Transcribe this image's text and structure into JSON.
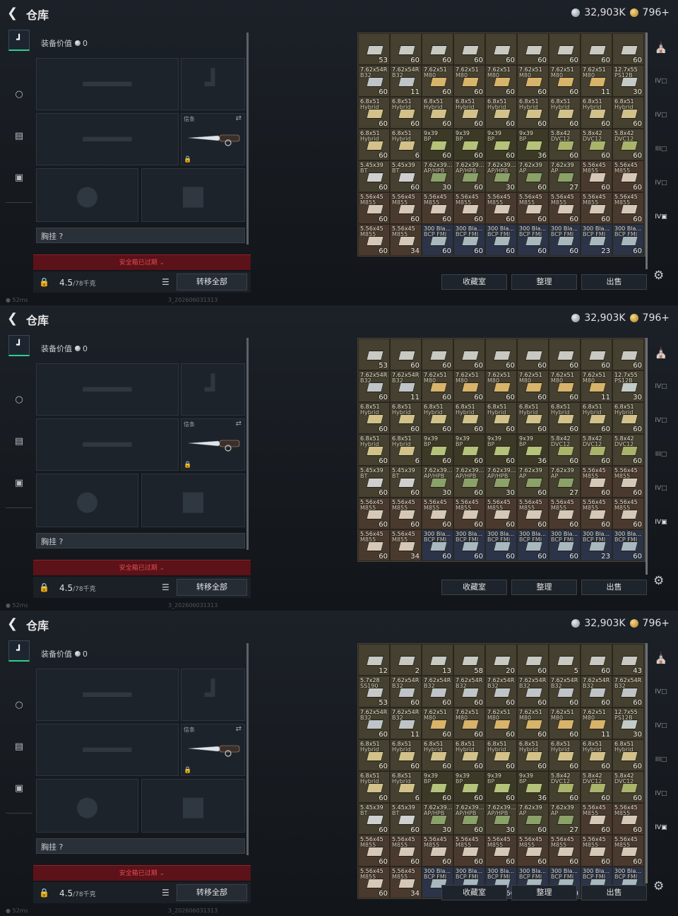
{
  "frames": [
    {
      "header": {
        "title": "仓库",
        "silver": "32,903K",
        "gold": "796+"
      },
      "equipment": {
        "value_label": "装备价值",
        "value": "0",
        "rig_label": "胸挂",
        "rig_help": "?",
        "expired": "安全箱已过期",
        "weight": "4.5",
        "weight_max": "/78千克",
        "transfer_all": "转移全部",
        "knife_tag": "信条"
      },
      "actions": {
        "collection": "收藏室",
        "sort": "整理",
        "sell": "出售"
      },
      "status": {
        "ping": "52ms",
        "build": "3_202606031313"
      },
      "rows": [
        [
          [
            "",
            "",
            "53"
          ],
          [
            "",
            "",
            "60"
          ],
          [
            "",
            "",
            "60"
          ],
          [
            "",
            "",
            "60"
          ],
          [
            "",
            "",
            "60"
          ],
          [
            "",
            "",
            "60"
          ],
          [
            "",
            "",
            "60"
          ],
          [
            "",
            "",
            "60"
          ],
          [
            "",
            "",
            "60"
          ]
        ],
        [
          [
            "7.62x54R",
            "B32",
            "60"
          ],
          [
            "7.62x54R",
            "B32",
            "11"
          ],
          [
            "7.62x51",
            "M80",
            "60"
          ],
          [
            "7.62x51",
            "M80",
            "60"
          ],
          [
            "7.62x51",
            "M80",
            "60"
          ],
          [
            "7.62x51",
            "M80",
            "60"
          ],
          [
            "7.62x51",
            "M80",
            "60"
          ],
          [
            "7.62x51",
            "M80",
            "11"
          ],
          [
            "12.7x55",
            "PS12B",
            "30"
          ]
        ],
        [
          [
            "6.8x51",
            "Hybrid",
            "60"
          ],
          [
            "6.8x51",
            "Hybrid",
            "60"
          ],
          [
            "6.8x51",
            "Hybrid",
            "60"
          ],
          [
            "6.8x51",
            "Hybrid",
            "60"
          ],
          [
            "6.8x51",
            "Hybrid",
            "60"
          ],
          [
            "6.8x51",
            "Hybrid",
            "60"
          ],
          [
            "6.8x51",
            "Hybrid",
            "60"
          ],
          [
            "6.8x51",
            "Hybrid",
            "60"
          ],
          [
            "6.8x51",
            "Hybrid",
            "60"
          ]
        ],
        [
          [
            "6.8x51",
            "Hybrid",
            "60"
          ],
          [
            "6.8x51",
            "Hybrid",
            "6"
          ],
          [
            "9x39",
            "BP",
            "60"
          ],
          [
            "9x39",
            "BP",
            "60"
          ],
          [
            "9x39",
            "BP",
            "60"
          ],
          [
            "9x39",
            "BP",
            "36"
          ],
          [
            "5.8x42",
            "DVC12",
            "60"
          ],
          [
            "5.8x42",
            "DVC12",
            "60"
          ],
          [
            "5.8x42",
            "DVC12",
            "60"
          ]
        ],
        [
          [
            "5.45x39",
            "BT",
            "60"
          ],
          [
            "5.45x39",
            "BT",
            "60"
          ],
          [
            "7.62x39...",
            "AP/HPB",
            "30"
          ],
          [
            "7.62x39...",
            "AP/HPB",
            "60"
          ],
          [
            "7.62x39...",
            "AP/HPB",
            "30"
          ],
          [
            "7.62x39",
            "AP",
            "60"
          ],
          [
            "7.62x39",
            "AP",
            "27"
          ],
          [
            "5.56x45",
            "M855",
            "60"
          ],
          [
            "5.56x45",
            "M855",
            "60"
          ]
        ],
        [
          [
            "5.56x45",
            "M855",
            "60"
          ],
          [
            "5.56x45",
            "M855",
            "60"
          ],
          [
            "5.56x45",
            "M855",
            "60"
          ],
          [
            "5.56x45",
            "M855",
            "60"
          ],
          [
            "5.56x45",
            "M855",
            "60"
          ],
          [
            "5.56x45",
            "M855",
            "60"
          ],
          [
            "5.56x45",
            "M855",
            "60"
          ],
          [
            "5.56x45",
            "M855",
            "60"
          ],
          [
            "5.56x45",
            "M855",
            "60"
          ]
        ],
        [
          [
            "5.56x45",
            "M855",
            "60"
          ],
          [
            "5.56x45",
            "M855",
            "34"
          ],
          [
            "300 Bla...",
            "BCP FMJ",
            "60"
          ],
          [
            "300 Bla...",
            "BCP FMJ",
            "60"
          ],
          [
            "300 Bla...",
            "BCP FMJ",
            "60"
          ],
          [
            "300 Bla...",
            "BCP FMJ",
            "60"
          ],
          [
            "300 Bla...",
            "BCP FMJ",
            "60"
          ],
          [
            "300 Bla...",
            "BCP FMJ",
            "23"
          ],
          [
            "300 Bla...",
            "BCP FMJ",
            "60"
          ]
        ]
      ]
    },
    {
      "header": {
        "title": "仓库",
        "silver": "32,903K",
        "gold": "796+"
      },
      "equipment": {
        "value_label": "装备价值",
        "value": "0",
        "rig_label": "胸挂",
        "rig_help": "?",
        "expired": "安全箱已过期",
        "weight": "4.5",
        "weight_max": "/78千克",
        "transfer_all": "转移全部",
        "knife_tag": "信条"
      },
      "actions": {
        "collection": "收藏室",
        "sort": "整理",
        "sell": "出售"
      },
      "status": {
        "ping": "52ms",
        "build": "3_202606031313"
      },
      "rows": [
        [
          [
            "",
            "",
            "53"
          ],
          [
            "",
            "",
            "60"
          ],
          [
            "",
            "",
            "60"
          ],
          [
            "",
            "",
            "60"
          ],
          [
            "",
            "",
            "60"
          ],
          [
            "",
            "",
            "60"
          ],
          [
            "",
            "",
            "60"
          ],
          [
            "",
            "",
            "60"
          ],
          [
            "",
            "",
            "60"
          ]
        ],
        [
          [
            "7.62x54R",
            "B32",
            "60"
          ],
          [
            "7.62x54R",
            "B32",
            "11"
          ],
          [
            "7.62x51",
            "M80",
            "60"
          ],
          [
            "7.62x51",
            "M80",
            "60"
          ],
          [
            "7.62x51",
            "M80",
            "60"
          ],
          [
            "7.62x51",
            "M80",
            "60"
          ],
          [
            "7.62x51",
            "M80",
            "60"
          ],
          [
            "7.62x51",
            "M80",
            "11"
          ],
          [
            "12.7x55",
            "PS12B",
            "30"
          ]
        ],
        [
          [
            "6.8x51",
            "Hybrid",
            "60"
          ],
          [
            "6.8x51",
            "Hybrid",
            "60"
          ],
          [
            "6.8x51",
            "Hybrid",
            "60"
          ],
          [
            "6.8x51",
            "Hybrid",
            "60"
          ],
          [
            "6.8x51",
            "Hybrid",
            "60"
          ],
          [
            "6.8x51",
            "Hybrid",
            "60"
          ],
          [
            "6.8x51",
            "Hybrid",
            "60"
          ],
          [
            "6.8x51",
            "Hybrid",
            "60"
          ],
          [
            "6.8x51",
            "Hybrid",
            "60"
          ]
        ],
        [
          [
            "6.8x51",
            "Hybrid",
            "60"
          ],
          [
            "6.8x51",
            "Hybrid",
            "6"
          ],
          [
            "9x39",
            "BP",
            "60"
          ],
          [
            "9x39",
            "BP",
            "60"
          ],
          [
            "9x39",
            "BP",
            "60"
          ],
          [
            "9x39",
            "BP",
            "36"
          ],
          [
            "5.8x42",
            "DVC12",
            "60"
          ],
          [
            "5.8x42",
            "DVC12",
            "60"
          ],
          [
            "5.8x42",
            "DVC12",
            "60"
          ]
        ],
        [
          [
            "5.45x39",
            "BT",
            "60"
          ],
          [
            "5.45x39",
            "BT",
            "60"
          ],
          [
            "7.62x39...",
            "AP/HPB",
            "30"
          ],
          [
            "7.62x39...",
            "AP/HPB",
            "60"
          ],
          [
            "7.62x39...",
            "AP/HPB",
            "30"
          ],
          [
            "7.62x39",
            "AP",
            "60"
          ],
          [
            "7.62x39",
            "AP",
            "27"
          ],
          [
            "5.56x45",
            "M855",
            "60"
          ],
          [
            "5.56x45",
            "M855",
            "60"
          ]
        ],
        [
          [
            "5.56x45",
            "M855",
            "60"
          ],
          [
            "5.56x45",
            "M855",
            "60"
          ],
          [
            "5.56x45",
            "M855",
            "60"
          ],
          [
            "5.56x45",
            "M855",
            "60"
          ],
          [
            "5.56x45",
            "M855",
            "60"
          ],
          [
            "5.56x45",
            "M855",
            "60"
          ],
          [
            "5.56x45",
            "M855",
            "60"
          ],
          [
            "5.56x45",
            "M855",
            "60"
          ],
          [
            "5.56x45",
            "M855",
            "60"
          ]
        ],
        [
          [
            "5.56x45",
            "M855",
            "60"
          ],
          [
            "5.56x45",
            "M855",
            "34"
          ],
          [
            "300 Bla...",
            "BCP FMJ",
            "60"
          ],
          [
            "300 Bla...",
            "BCP FMJ",
            "60"
          ],
          [
            "300 Bla...",
            "BCP FMJ",
            "60"
          ],
          [
            "300 Bla...",
            "BCP FMJ",
            "60"
          ],
          [
            "300 Bla...",
            "BCP FMJ",
            "60"
          ],
          [
            "300 Bla...",
            "BCP FMJ",
            "23"
          ],
          [
            "300 Bla...",
            "BCP FMJ",
            "60"
          ]
        ]
      ]
    },
    {
      "header": {
        "title": "仓库",
        "silver": "32,903K",
        "gold": "796+"
      },
      "equipment": {
        "value_label": "装备价值",
        "value": "0",
        "rig_label": "胸挂",
        "rig_help": "?",
        "expired": "安全箱已过期",
        "weight": "4.5",
        "weight_max": "/78千克",
        "transfer_all": "转移全部",
        "knife_tag": "信条"
      },
      "actions": {
        "collection": "收藏室",
        "sort": "整理",
        "sell": "出售"
      },
      "status": {
        "ping": "52ms",
        "build": "3_202606031313"
      },
      "rows": [
        [
          [
            "",
            "",
            "12"
          ],
          [
            "",
            "",
            "2"
          ],
          [
            "",
            "",
            "13"
          ],
          [
            "",
            "",
            "58"
          ],
          [
            "",
            "",
            "20"
          ],
          [
            "",
            "",
            "60"
          ],
          [
            "",
            "",
            "5"
          ],
          [
            "",
            "",
            "60"
          ],
          [
            "",
            "",
            "43"
          ]
        ],
        [
          [
            "5.7x28",
            "SS190",
            "53"
          ],
          [
            "7.62x54R",
            "B32",
            "60"
          ],
          [
            "7.62x54R",
            "B32",
            "60"
          ],
          [
            "7.62x54R",
            "B32",
            "60"
          ],
          [
            "7.62x54R",
            "B32",
            "60"
          ],
          [
            "7.62x54R",
            "B32",
            "60"
          ],
          [
            "7.62x54R",
            "B32",
            "60"
          ],
          [
            "7.62x54R",
            "B32",
            "60"
          ],
          [
            "7.62x54R",
            "B32",
            "60"
          ]
        ],
        [
          [
            "7.62x54R",
            "B32",
            "60"
          ],
          [
            "7.62x54R",
            "B32",
            "11"
          ],
          [
            "7.62x51",
            "M80",
            "60"
          ],
          [
            "7.62x51",
            "M80",
            "60"
          ],
          [
            "7.62x51",
            "M80",
            "60"
          ],
          [
            "7.62x51",
            "M80",
            "60"
          ],
          [
            "7.62x51",
            "M80",
            "60"
          ],
          [
            "7.62x51",
            "M80",
            "11"
          ],
          [
            "12.7x55",
            "PS12B",
            "30"
          ]
        ],
        [
          [
            "6.8x51",
            "Hybrid",
            "60"
          ],
          [
            "6.8x51",
            "Hybrid",
            "60"
          ],
          [
            "6.8x51",
            "Hybrid",
            "60"
          ],
          [
            "6.8x51",
            "Hybrid",
            "60"
          ],
          [
            "6.8x51",
            "Hybrid",
            "60"
          ],
          [
            "6.8x51",
            "Hybrid",
            "60"
          ],
          [
            "6.8x51",
            "Hybrid",
            "60"
          ],
          [
            "6.8x51",
            "Hybrid",
            "60"
          ],
          [
            "6.8x51",
            "Hybrid",
            "60"
          ]
        ],
        [
          [
            "6.8x51",
            "Hybrid",
            "60"
          ],
          [
            "6.8x51",
            "Hybrid",
            "6"
          ],
          [
            "9x39",
            "BP",
            "60"
          ],
          [
            "9x39",
            "BP",
            "60"
          ],
          [
            "9x39",
            "BP",
            "60"
          ],
          [
            "9x39",
            "BP",
            "36"
          ],
          [
            "5.8x42",
            "DVC12",
            "60"
          ],
          [
            "5.8x42",
            "DVC12",
            "60"
          ],
          [
            "5.8x42",
            "DVC12",
            "60"
          ]
        ],
        [
          [
            "5.45x39",
            "BT",
            "60"
          ],
          [
            "5.45x39",
            "BT",
            "60"
          ],
          [
            "7.62x39...",
            "AP/HPB",
            "30"
          ],
          [
            "7.62x39...",
            "AP/HPB",
            "60"
          ],
          [
            "7.62x39...",
            "AP/HPB",
            "30"
          ],
          [
            "7.62x39",
            "AP",
            "60"
          ],
          [
            "7.62x39",
            "AP",
            "27"
          ],
          [
            "5.56x45",
            "M855",
            "60"
          ],
          [
            "5.56x45",
            "M855",
            "60"
          ]
        ],
        [
          [
            "5.56x45",
            "M855",
            "60"
          ],
          [
            "5.56x45",
            "M855",
            "60"
          ],
          [
            "5.56x45",
            "M855",
            "60"
          ],
          [
            "5.56x45",
            "M855",
            "60"
          ],
          [
            "5.56x45",
            "M855",
            "60"
          ],
          [
            "5.56x45",
            "M855",
            "60"
          ],
          [
            "5.56x45",
            "M855",
            "60"
          ],
          [
            "5.56x45",
            "M855",
            "60"
          ],
          [
            "5.56x45",
            "M855",
            "60"
          ]
        ],
        [
          [
            "5.56x45",
            "M855",
            "60"
          ],
          [
            "5.56x45",
            "M855",
            "34"
          ],
          [
            "300 Bla...",
            "BCP FMJ",
            "60"
          ],
          [
            "300 Bla...",
            "BCP FMJ",
            "60"
          ],
          [
            "300 Bla...",
            "BCP FMJ",
            "60"
          ],
          [
            "300 Bla...",
            "BCP FMJ",
            "60"
          ],
          [
            "300 Bla...",
            "BCP FMJ",
            "60"
          ],
          [
            "300 Bla...",
            "BCP FMJ",
            "23"
          ],
          [
            "300 Bla...",
            "BCP FMJ",
            "60"
          ]
        ]
      ]
    }
  ],
  "colors": {
    "accent": "#2fd08b",
    "expired_bg": "#5b1218",
    "expired_text": "#e04c52"
  }
}
